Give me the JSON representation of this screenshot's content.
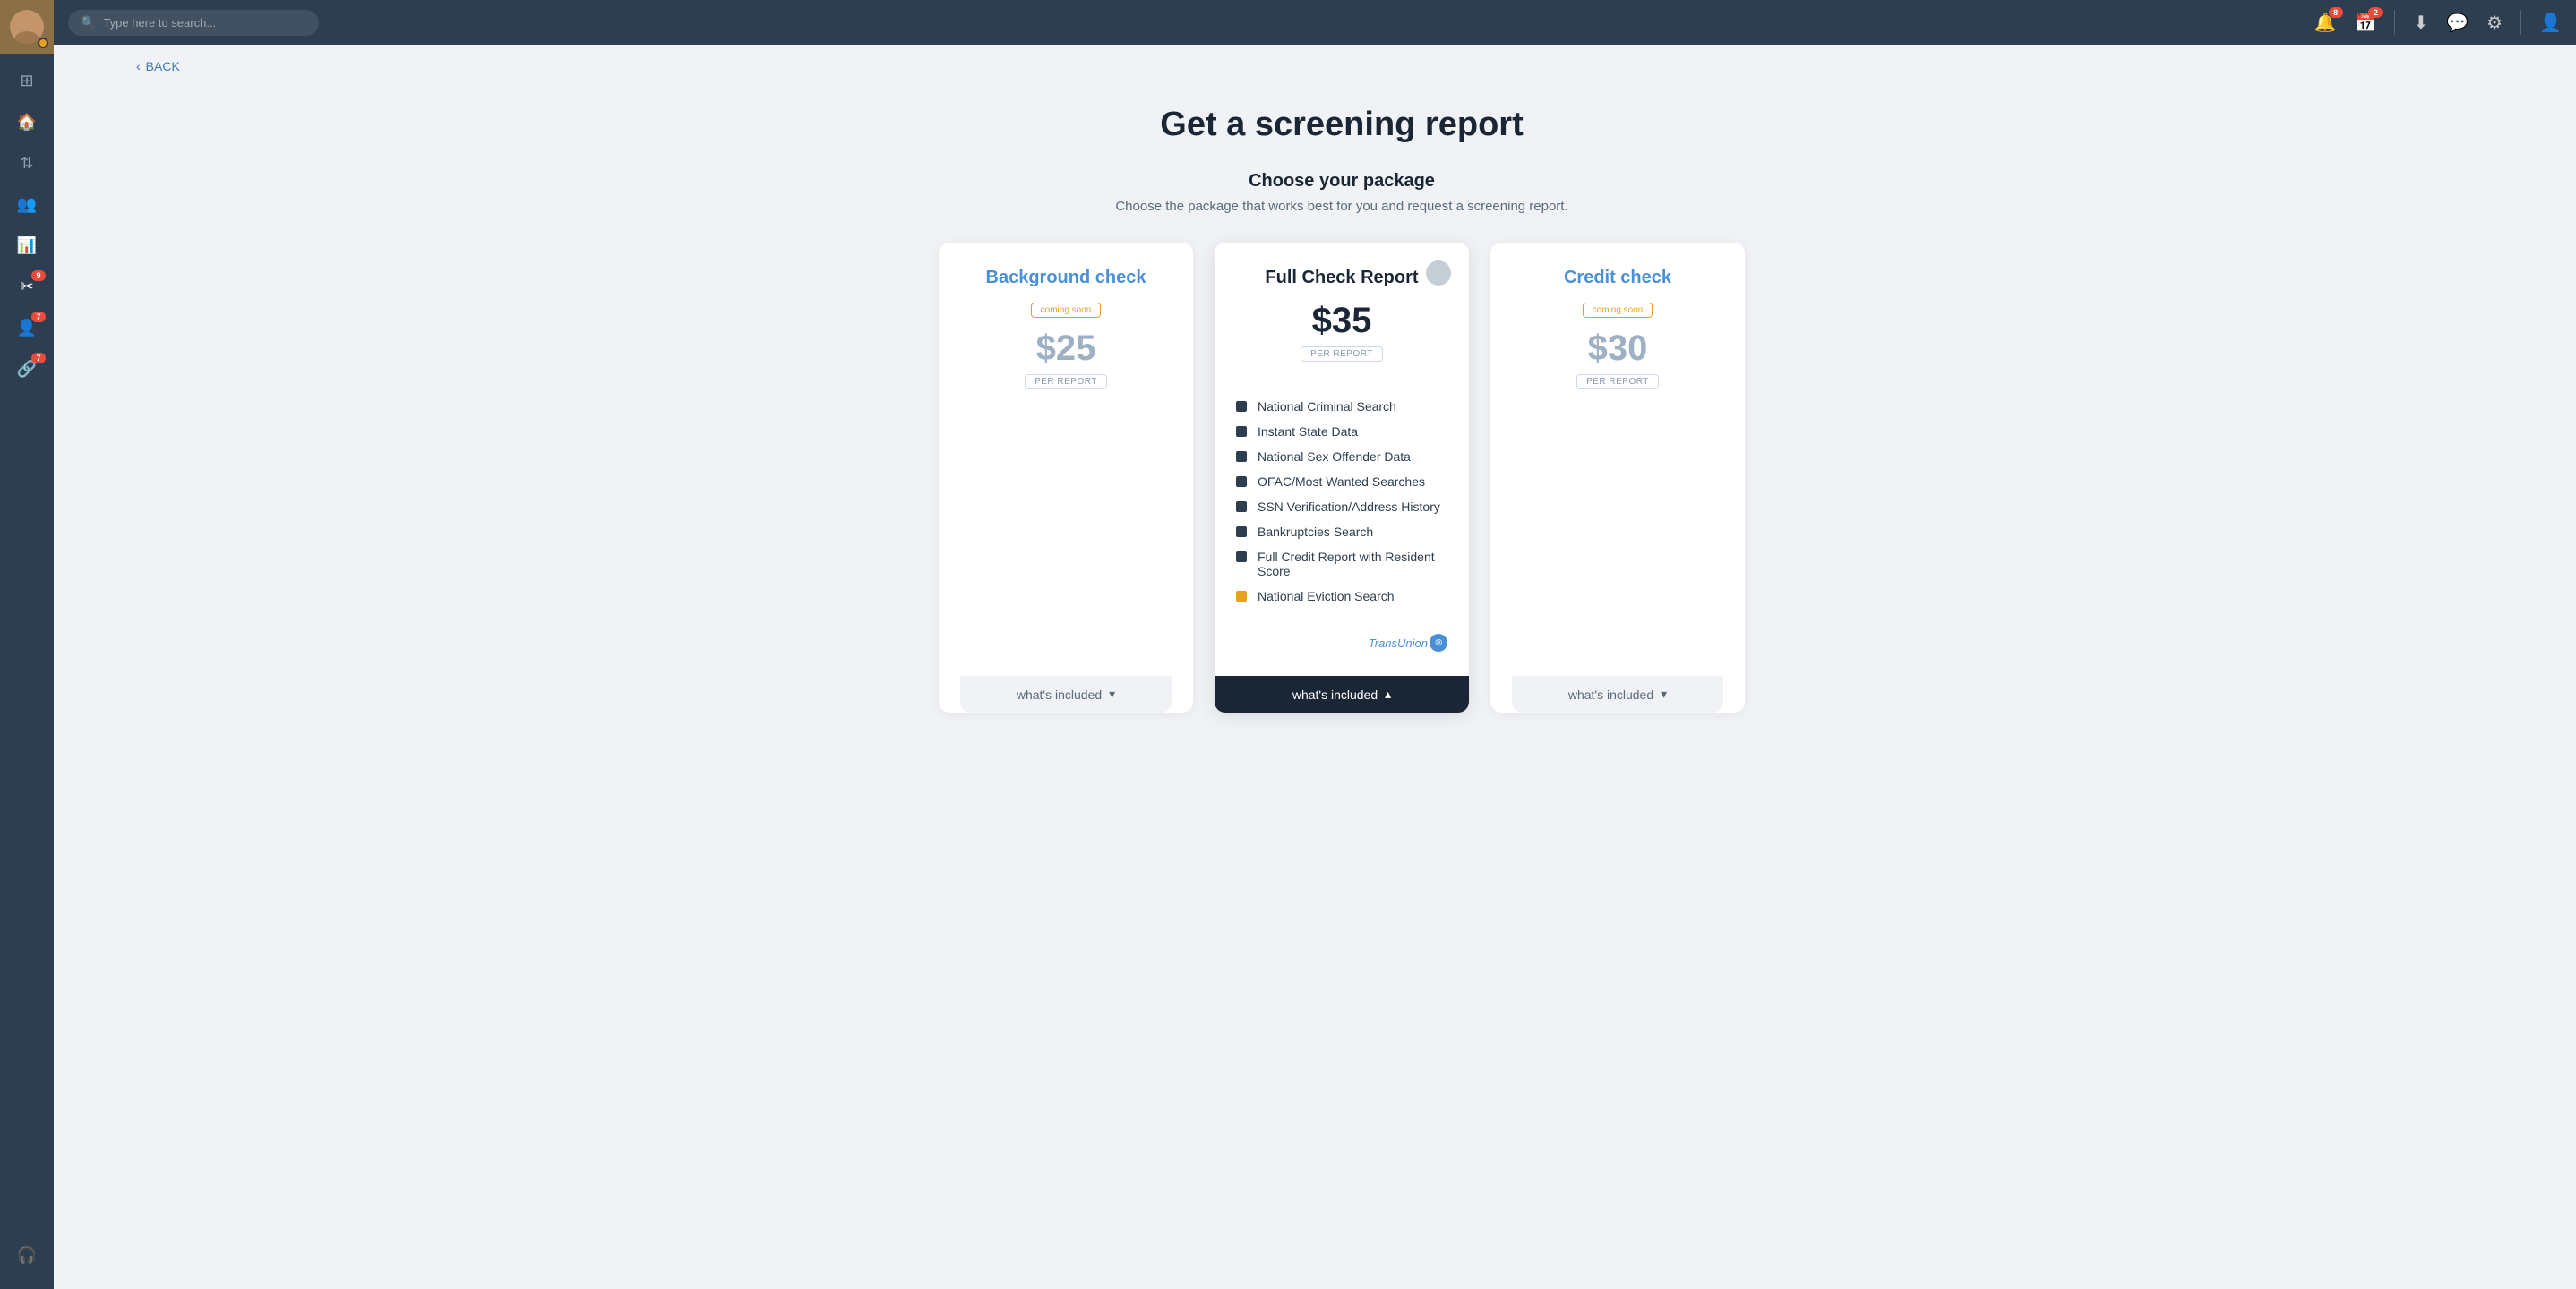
{
  "topbar": {
    "search_placeholder": "Type here to search...",
    "notifications_badge": "8",
    "calendar_badge": "2"
  },
  "back": {
    "label": "BACK"
  },
  "page": {
    "title": "Get a screening report"
  },
  "packages_section": {
    "subtitle": "Choose your package",
    "description": "Choose the package that works best for you and request a screening report.",
    "packages": [
      {
        "id": "background",
        "title": "Background check",
        "coming_soon": true,
        "coming_soon_label": "coming soon",
        "price": "$25",
        "per_report": "PER REPORT",
        "whats_included": "what's included",
        "featured": false
      },
      {
        "id": "full",
        "title": "Full Check Report",
        "coming_soon": false,
        "price": "$35",
        "per_report": "PER REPORT",
        "whats_included": "what's included",
        "featured": true
      },
      {
        "id": "credit",
        "title": "Credit check",
        "coming_soon": true,
        "coming_soon_label": "coming soon",
        "price": "$30",
        "per_report": "PER REPORT",
        "whats_included": "what's included",
        "featured": false
      }
    ],
    "features": [
      {
        "label": "National Criminal Search",
        "type": "dark"
      },
      {
        "label": "Instant State Data",
        "type": "dark"
      },
      {
        "label": "National Sex Offender Data",
        "type": "dark"
      },
      {
        "label": "OFAC/Most Wanted Searches",
        "type": "dark"
      },
      {
        "label": "SSN Verification/Address History",
        "type": "dark"
      },
      {
        "label": "Bankruptcies Search",
        "type": "dark"
      },
      {
        "label": "Full Credit Report with Resident Score",
        "type": "dark"
      },
      {
        "label": "National Eviction Search",
        "type": "orange"
      }
    ],
    "transunion_label": "TransUnion"
  },
  "sidebar": {
    "items": [
      {
        "icon": "⊞",
        "label": "dashboard",
        "badge": null
      },
      {
        "icon": "🏠",
        "label": "properties",
        "badge": null
      },
      {
        "icon": "↕",
        "label": "transactions",
        "badge": null
      },
      {
        "icon": "👥",
        "label": "tenants",
        "badge": null
      },
      {
        "icon": "📊",
        "label": "reports",
        "badge": null
      },
      {
        "icon": "✂",
        "label": "tools",
        "badge": "9"
      },
      {
        "icon": "👤",
        "label": "contacts",
        "badge": "7"
      },
      {
        "icon": "🔗",
        "label": "links",
        "badge": "7"
      }
    ]
  }
}
